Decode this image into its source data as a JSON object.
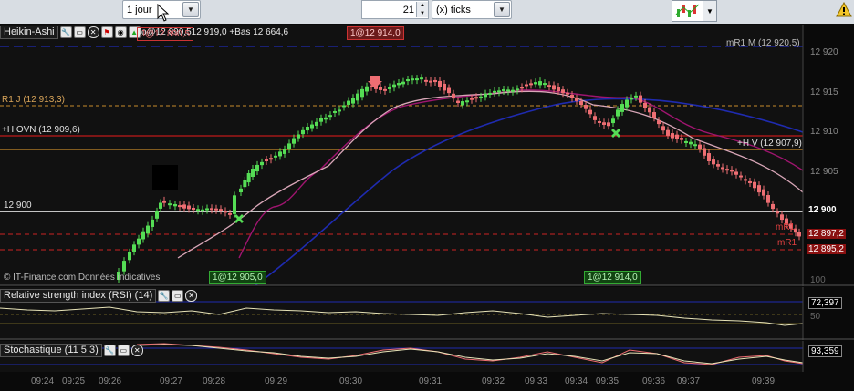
{
  "toolbar": {
    "period": "1 jour",
    "units_value": "21",
    "units_type": "(x) ticks"
  },
  "main_panel": {
    "title": "Heikin-Ashi",
    "info": "Jo@12 890,512 919,0 +Bas 12 664,6",
    "info_badge": "J@12 890,5",
    "order_top": "1@12 914,0",
    "order_left": "1@12 905,0",
    "order_right": "1@12 914,0",
    "copyright": "© IT-Finance.com  Données indicatives",
    "levels": {
      "mr1_m": "mR1 M (12 920,5)",
      "r1_j": "R1 J (12 913,3)",
      "h_ovn": "+H OVN (12 909,6)",
      "h_v": "+H V (12 907,9)",
      "round": "12 900",
      "mr1_a": "mR1",
      "mr1_b": "mR1"
    },
    "price_axis": [
      "12 920",
      "12 915",
      "12 910",
      "12 905",
      "12 900",
      "12 895,2"
    ],
    "price_tags": {
      "p1": "12 897,2",
      "p2": "12 895,2"
    },
    "axis_bottom": "100"
  },
  "rsi_panel": {
    "title": "Relative strength index (RSI) (14)",
    "value": "72,397",
    "mid_label": "50"
  },
  "stoch_panel": {
    "title": "Stochastique (11 5 3)",
    "value": "93,359"
  },
  "time_axis": [
    "09:24",
    "09:25",
    "09:26",
    "09:27",
    "09:28",
    "09:29",
    "09:30",
    "09:31",
    "09:32",
    "09:33",
    "09:34",
    "09:35",
    "09:36",
    "09:37",
    "09:39"
  ],
  "colors": {
    "bull": "#55dd55",
    "bear": "#ee6e73",
    "ma_blue": "#1f2bb0",
    "ma_pink": "#d9a7b8",
    "ma_magenta": "#a01570",
    "level_orange": "#c68a2a",
    "level_red": "#cc2222"
  }
}
